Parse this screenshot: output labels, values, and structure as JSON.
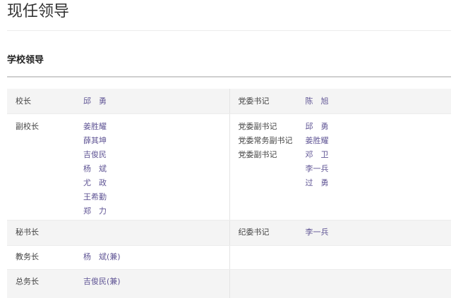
{
  "page": {
    "title": "现任领导"
  },
  "section": {
    "title": "学校领导"
  },
  "rows": [
    {
      "left_label": "校长",
      "left_names": [
        "邱　勇"
      ],
      "right_labels": [
        "党委书记"
      ],
      "right_names": [
        "陈　旭"
      ]
    },
    {
      "left_label": "副校长",
      "left_names": [
        "姜胜耀",
        "薛其坤",
        "吉俊民",
        "杨　斌",
        "尤　政",
        "王希勤",
        "郑　力"
      ],
      "right_labels": [
        "党委副书记",
        "党委常务副书记",
        "党委副书记"
      ],
      "right_names": [
        "邱　勇",
        "姜胜耀",
        "邓　卫",
        "李一兵",
        "过　勇"
      ]
    },
    {
      "left_label": "秘书长",
      "left_names": [],
      "right_labels": [
        "纪委书记"
      ],
      "right_names": [
        "李一兵"
      ]
    },
    {
      "left_label": "教务长",
      "left_names": [
        "杨　斌(兼)"
      ],
      "right_labels": [],
      "right_names": []
    },
    {
      "left_label": "总务长",
      "left_names": [
        "吉俊民(兼)"
      ],
      "right_labels": [],
      "right_names": []
    }
  ]
}
